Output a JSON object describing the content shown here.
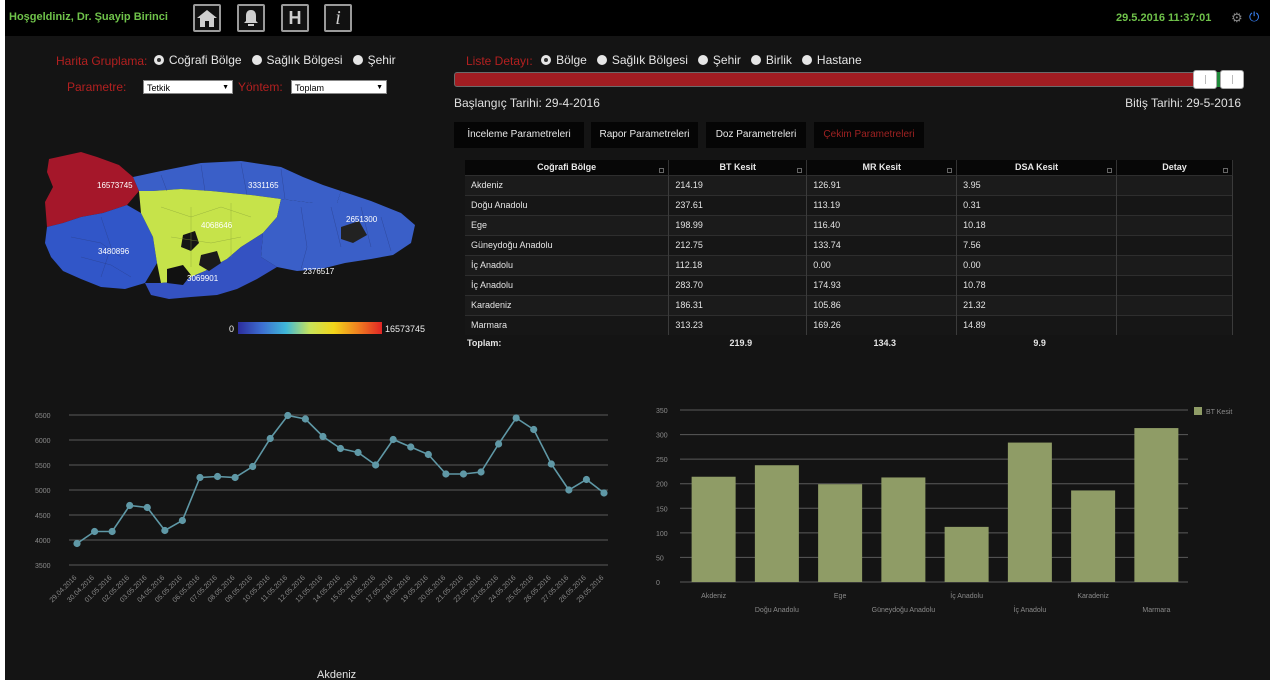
{
  "header": {
    "welcome": "Hoşgeldiniz, Dr. Şuayip Birinci",
    "icons": [
      "home-icon",
      "bell-icon",
      "h-icon",
      "info-icon"
    ],
    "icon_glyphs": {
      "h": "H",
      "info": "i"
    },
    "datetime": "29.5.2016 11:37:01"
  },
  "left_controls": {
    "grouping_label": "Harita Gruplama:",
    "grouping_options": [
      {
        "label": "Coğrafi Bölge",
        "checked": true
      },
      {
        "label": "Sağlık Bölgesi",
        "checked": false
      },
      {
        "label": "Şehir",
        "checked": false
      }
    ],
    "parameter_label": "Parametre:",
    "parameter_value": "Tetkik",
    "method_label": "Yöntem:",
    "method_value": "Toplam"
  },
  "list_controls": {
    "label": "Liste Detayı:",
    "options": [
      {
        "label": "Bölge",
        "checked": true
      },
      {
        "label": "Sağlık Bölgesi",
        "checked": false
      },
      {
        "label": "Şehir",
        "checked": false
      },
      {
        "label": "Birlik",
        "checked": false
      },
      {
        "label": "Hastane",
        "checked": false
      }
    ]
  },
  "date_range": {
    "start_label": "Başlangıç Tarihi: 29-4-2016",
    "end_label": "Bitiş Tarihi: 29-5-2016",
    "selected_fraction": [
      0.957,
      1.0
    ]
  },
  "param_tabs": [
    {
      "label": "İnceleme Parametreleri",
      "active": false
    },
    {
      "label": "Rapor Parametreleri",
      "active": false
    },
    {
      "label": "Doz Parametreleri",
      "active": false
    },
    {
      "label": "Çekim Parametreleri",
      "active": true
    }
  ],
  "table": {
    "columns": [
      "Coğrafi Bölge",
      "BT Kesit",
      "MR Kesit",
      "DSA Kesit",
      "Detay"
    ],
    "rows": [
      [
        "Akdeniz",
        "214.19",
        "126.91",
        "3.95",
        ""
      ],
      [
        "Doğu Anadolu",
        "237.61",
        "113.19",
        "0.31",
        ""
      ],
      [
        "Ege",
        "198.99",
        "116.40",
        "10.18",
        ""
      ],
      [
        "Güneydoğu Anadolu",
        "212.75",
        "133.74",
        "7.56",
        ""
      ],
      [
        "İç Anadolu",
        "112.18",
        "0.00",
        "0.00",
        ""
      ],
      [
        "İç Anadolu",
        "283.70",
        "174.93",
        "10.78",
        ""
      ],
      [
        "Karadeniz",
        "186.31",
        "105.86",
        "21.32",
        ""
      ],
      [
        "Marmara",
        "313.23",
        "169.26",
        "14.89",
        ""
      ]
    ],
    "total_label": "Toplam:",
    "totals": [
      "219.9",
      "134.3",
      "9.9"
    ]
  },
  "map": {
    "labels": [
      "16573745",
      "3331165",
      "4068646",
      "2651300",
      "3480896",
      "2376517",
      "3069901"
    ],
    "legend_min": "0",
    "legend_max": "16573745",
    "colors": {
      "marmara": "#a5172a",
      "west": "#3156c8",
      "central": "#c6e34a",
      "east": "#3a5fc8",
      "dark": "#1a1a1a"
    }
  },
  "chart_data": [
    {
      "type": "line",
      "x": [
        "29.04.2016",
        "30.04.2016",
        "01.05.2016",
        "02.05.2016",
        "03.05.2016",
        "04.05.2016",
        "05.05.2016",
        "06.05.2016",
        "07.05.2016",
        "08.05.2016",
        "09.05.2016",
        "10.05.2016",
        "11.05.2016",
        "12.05.2016",
        "13.05.2016",
        "14.05.2016",
        "15.05.2016",
        "16.05.2016",
        "17.05.2016",
        "18.05.2016",
        "19.05.2016",
        "20.05.2016",
        "21.05.2016",
        "22.05.2016",
        "23.05.2016",
        "24.05.2016",
        "25.05.2016",
        "26.05.2016",
        "27.05.2016",
        "28.05.2016",
        "29.05.2016"
      ],
      "series": [
        {
          "values": [
            3930,
            4170,
            4170,
            4690,
            4650,
            4190,
            4390,
            5250,
            5270,
            5250,
            5470,
            6030,
            6490,
            6420,
            6070,
            5830,
            5750,
            5500,
            6010,
            5860,
            5710,
            5320,
            5320,
            5360,
            5920,
            6440,
            6210,
            5520,
            5000,
            5210,
            4940
          ]
        }
      ],
      "yticks": [
        3500,
        4000,
        4500,
        5000,
        5500,
        6000,
        6500
      ],
      "ylim": [
        3400,
        6600
      ],
      "color": "#5f98a6",
      "grid": true
    },
    {
      "type": "bar",
      "categories": [
        "Akdeniz",
        "Doğu Anadolu",
        "Ege",
        "Güneydoğu Anadolu",
        "İç Anadolu",
        "İç Anadolu",
        "Karadeniz",
        "Marmara"
      ],
      "series": [
        {
          "name": "BT Kesit",
          "values": [
            214.19,
            237.61,
            198.99,
            212.75,
            112.18,
            283.7,
            186.31,
            313.23
          ]
        }
      ],
      "yticks": [
        0,
        50,
        100,
        150,
        200,
        250,
        300,
        350
      ],
      "ylim": [
        0,
        350
      ],
      "color": "#8f9c66",
      "legend": "top-right",
      "grid": true
    }
  ],
  "footer": {
    "caption": "Akdeniz"
  }
}
